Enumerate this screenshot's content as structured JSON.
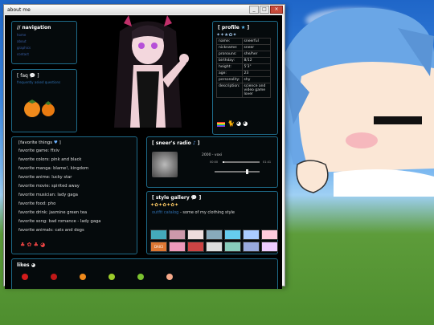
{
  "window": {
    "title": "about me",
    "min_label": "_",
    "max_label": "□",
    "close_label": "×"
  },
  "navigation": {
    "title": "// navigation",
    "links": [
      "home",
      "about",
      "graphics",
      "contact"
    ]
  },
  "faq": {
    "title": "[ faq",
    "link_text": "frequently asked questions"
  },
  "profile": {
    "title": "[ profile",
    "rows": [
      {
        "label": "name:",
        "value": "sneerful"
      },
      {
        "label": "nickname:",
        "value": "sneer"
      },
      {
        "label": "pronouns:",
        "value": "she/her"
      },
      {
        "label": "birthday:",
        "value": "8/12"
      },
      {
        "label": "height:",
        "value": "5'3\""
      },
      {
        "label": "age:",
        "value": "23"
      },
      {
        "label": "personality:",
        "value": "shy"
      },
      {
        "label": "description:",
        "value": "science and video game lover"
      }
    ]
  },
  "favorites": {
    "title": "[favorite things",
    "title_end": "]",
    "items": [
      "favorite game: ffxiv",
      "favorite colors: pink and black",
      "favorite manga: blame!, kingdom",
      "favorite anime: lucky star",
      "favorite movie: spirited away",
      "favorite musician: lady gaga",
      "favorite food: pho",
      "favorite drink: jasmine green tea",
      "favorite song: bad romance - lady gaga",
      "favorite animals: cats and dogs"
    ]
  },
  "radio": {
    "title": "[ sneer's radio",
    "title_end": "]",
    "track": "2000 - voxi",
    "time_start": "00:00",
    "time_end": "01:41",
    "progress": 0.05,
    "volume": 0.7
  },
  "gallery": {
    "title": "[ style gallery",
    "title_end": "]",
    "link_text": "outfit catalog",
    "caption": " - some of my clothing style",
    "badge_text": "DAICI"
  },
  "likes": {
    "title": "likes"
  },
  "colors": {
    "accent": "#1e6b8a",
    "link": "#2f6fb0",
    "bg": "#000000"
  }
}
